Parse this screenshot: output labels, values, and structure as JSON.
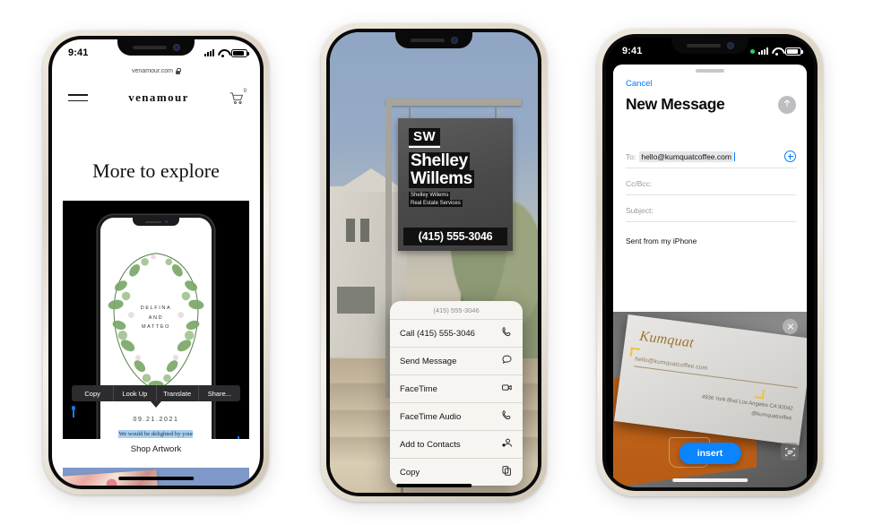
{
  "scene": {
    "background_color": "#ffffff",
    "device_count": 3
  },
  "phone1": {
    "name": "venamour-safari-live-text",
    "status": {
      "time": "9:41"
    },
    "browser": {
      "url": "venamour.com",
      "lock_icon": "lock-icon"
    },
    "nav": {
      "menu_icon": "hamburger-menu-icon",
      "brand": "venamour",
      "cart_icon": "shopping-cart-icon",
      "cart_count": "0"
    },
    "heading": "More to explore",
    "invitation": {
      "names": [
        "DELFINA",
        "AND",
        "MATTEO"
      ],
      "date": "09.21.2021",
      "selected_text": "We would be delighted by your presence at our intimate wedding celebration. We treasure",
      "selection_color": "#a8cdf0"
    },
    "edit_menu": {
      "items": [
        "Copy",
        "Look Up",
        "Translate",
        "Share..."
      ]
    },
    "shop_link": "Shop Artwork"
  },
  "phone2": {
    "name": "camera-live-text-phone-number",
    "sign": {
      "monogram": "SW",
      "name_line1": "Shelley",
      "name_line2": "Willems",
      "sub_line1": "Shelley Willems",
      "sub_line2": "Real Estate Services",
      "phone": "(415) 555-3046"
    },
    "context_menu": {
      "header": "(415) 555-3046",
      "items": [
        {
          "label": "Call (415) 555-3046",
          "icon": "phone-icon"
        },
        {
          "label": "Send Message",
          "icon": "message-bubble-icon"
        },
        {
          "label": "FaceTime",
          "icon": "video-camera-icon"
        },
        {
          "label": "FaceTime Audio",
          "icon": "phone-icon"
        },
        {
          "label": "Add to Contacts",
          "icon": "person-add-icon"
        },
        {
          "label": "Copy",
          "icon": "copy-icon"
        }
      ]
    }
  },
  "phone3": {
    "name": "mail-compose-live-text-insert",
    "status": {
      "time": "9:41",
      "camera_indicator": "green-dot-icon"
    },
    "compose": {
      "cancel": "Cancel",
      "title": "New Message",
      "send_icon": "send-arrow-up-icon",
      "to_label": "To:",
      "to_value": "hello@kumquatcoffee.com",
      "add_contact_icon": "plus-circle-icon",
      "cc_placeholder": "Cc/Bcc:",
      "subject_placeholder": "Subject:",
      "signature": "Sent from my iPhone"
    },
    "scanner": {
      "close_icon": "close-x-icon",
      "insert_label": "insert",
      "scan_icon": "text-scan-icon",
      "accent_color": "#0a84ff",
      "card": {
        "brand": "Kumquat",
        "email": "hello@kumquatcoffee.com",
        "address": "4936 York Blvd Los Angeles CA 90042",
        "handle": "@kumquatcoffee"
      }
    }
  }
}
